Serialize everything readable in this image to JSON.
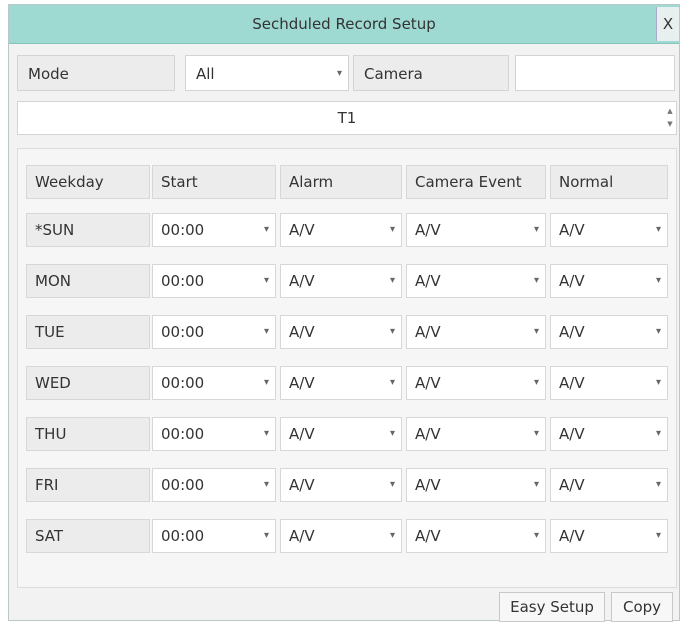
{
  "dialog": {
    "title": "Sechduled Record Setup",
    "close_label": "X"
  },
  "top": {
    "mode_label": "Mode",
    "mode_value": "All",
    "camera_label": "Camera",
    "camera_value": ""
  },
  "schedule": {
    "value": "T1"
  },
  "table": {
    "headers": [
      "Weekday",
      "Start",
      "Alarm",
      "Camera Event",
      "Normal"
    ],
    "rows": [
      {
        "day": "*SUN",
        "start": "00:00",
        "alarm": "A/V",
        "camera_event": "A/V",
        "normal": "A/V"
      },
      {
        "day": "MON",
        "start": "00:00",
        "alarm": "A/V",
        "camera_event": "A/V",
        "normal": "A/V"
      },
      {
        "day": "TUE",
        "start": "00:00",
        "alarm": "A/V",
        "camera_event": "A/V",
        "normal": "A/V"
      },
      {
        "day": "WED",
        "start": "00:00",
        "alarm": "A/V",
        "camera_event": "A/V",
        "normal": "A/V"
      },
      {
        "day": "THU",
        "start": "00:00",
        "alarm": "A/V",
        "camera_event": "A/V",
        "normal": "A/V"
      },
      {
        "day": "FRI",
        "start": "00:00",
        "alarm": "A/V",
        "camera_event": "A/V",
        "normal": "A/V"
      },
      {
        "day": "SAT",
        "start": "00:00",
        "alarm": "A/V",
        "camera_event": "A/V",
        "normal": "A/V"
      }
    ]
  },
  "buttons": {
    "easy_setup": "Easy Setup",
    "copy": "Copy"
  },
  "icons": {
    "dropdown": "dropdown-arrow-icon",
    "spinner": "spinner-arrows-icon"
  },
  "colors": {
    "titlebar": "#9ed9d2",
    "panel": "#f2f2f2"
  }
}
